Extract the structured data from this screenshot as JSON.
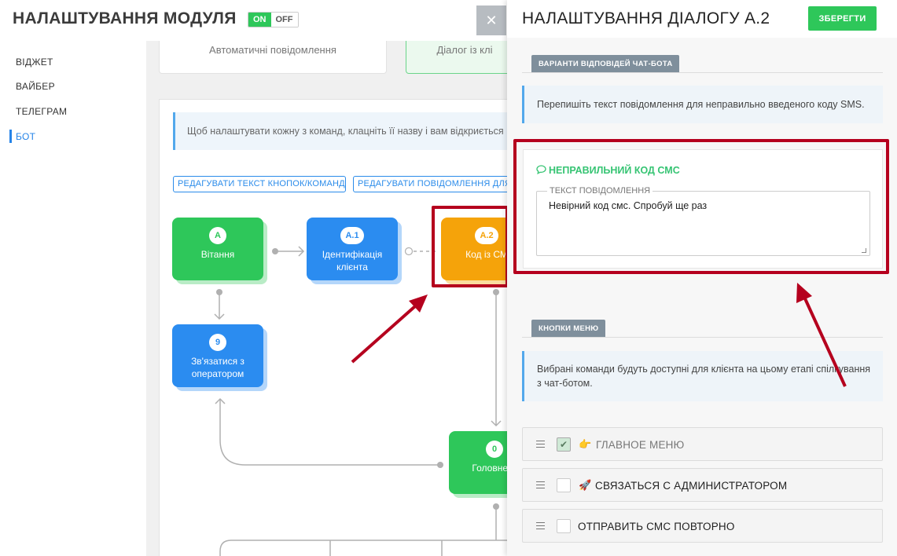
{
  "module": {
    "title": "НАЛАШТУВАННЯ МОДУЛЯ",
    "toggle_on": "ON",
    "toggle_off": "OFF",
    "close_symbol": "✕"
  },
  "sidebar": {
    "items": [
      {
        "label": "ВІДЖЕТ"
      },
      {
        "label": "ВАЙБЕР"
      },
      {
        "label": "ТЕЛЕГРАМ"
      },
      {
        "label": "БОТ",
        "active": true
      }
    ]
  },
  "tabs": [
    {
      "label": "Автоматичні повідомлення"
    },
    {
      "label": "Діалог із клі"
    }
  ],
  "bot_panel": {
    "hint": "Щоб налаштувати кожну з команд, клацніть її назву і вам відкриється",
    "edit_buttons_label": "РЕДАГУВАТИ ТЕКСТ КНОПОК/КОМАНД",
    "edit_messages_label": "РЕДАГУВАТИ ПОВІДОМЛЕННЯ ДЛЯ"
  },
  "diagram": {
    "nodes": [
      {
        "badge": "A",
        "label": "Вітання",
        "color": "green"
      },
      {
        "badge": "A.1",
        "label": "Ідентифікація клієнта",
        "color": "blue"
      },
      {
        "badge": "A.2",
        "label": "Код із СМ",
        "color": "orange"
      },
      {
        "badge": "9",
        "label": "Зв'язатися з оператором",
        "color": "blue"
      },
      {
        "badge": "0",
        "label": "Головне м",
        "color": "green"
      }
    ]
  },
  "drawer": {
    "title": "НАЛАШТУВАННЯ ДІАЛОГУ А.2",
    "save_label": "ЗБЕРЕГТИ",
    "answers_section": {
      "tab_label": "ВАРІАНТИ ВІДПОВІДЕЙ ЧАТ-БОТА",
      "info": "Перепишіть текст повідомлення для неправильно введеного коду SMS."
    },
    "message_card": {
      "title": "НЕПРАВИЛЬНИЙ КОД СМС",
      "field_label": "ТЕКСТ ПОВІДОМЛЕННЯ",
      "field_value": "Невірний код смс. Спробуй ще раз"
    },
    "menu_section": {
      "tab_label": "КНОПКИ МЕНЮ",
      "info": "Вибрані команди будуть доступні для клієнта на цьому етапі спілкування з чат-ботом.",
      "rows": [
        {
          "label": "ГЛАВНОЕ МЕНЮ",
          "checked": true,
          "emoji": "👉",
          "checkmark": "✔"
        },
        {
          "label": "СВЯЗАТЬСЯ С АДМИНИСТРАТОРОМ",
          "checked": false,
          "emoji": "🚀"
        },
        {
          "label": "ОТПРАВИТЬ СМС ПОВТОРНО",
          "checked": false,
          "emoji": ""
        }
      ]
    }
  },
  "colors": {
    "green": "#2ec75a",
    "blue": "#2b8cf0",
    "orange": "#f5a30a",
    "annotation_red": "#b5001e",
    "link_blue": "#2684e8"
  }
}
